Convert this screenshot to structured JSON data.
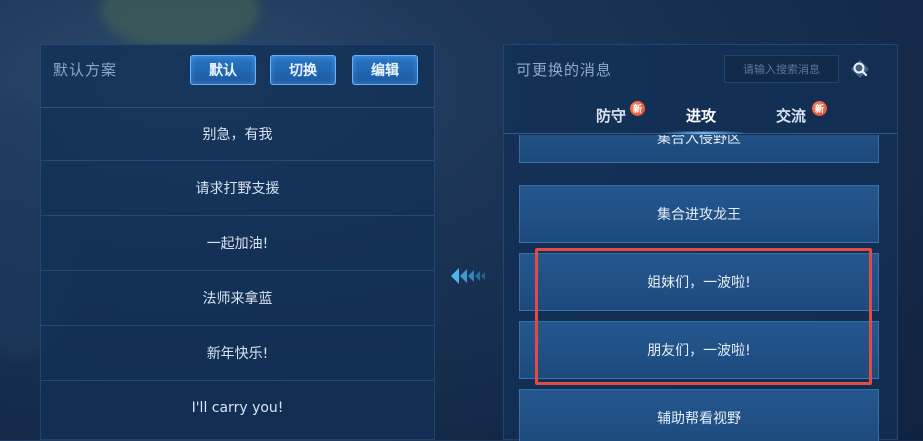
{
  "left_panel": {
    "title": "默认方案",
    "buttons": [
      {
        "label": "默认"
      },
      {
        "label": "切换"
      },
      {
        "label": "编辑"
      }
    ],
    "messages": [
      "别急，有我",
      "请求打野支援",
      "一起加油!",
      "法师来拿蓝",
      "新年快乐!",
      "I'll carry you!"
    ]
  },
  "right_panel": {
    "title": "可更换的消息",
    "search": {
      "placeholder": "请输入搜索消息"
    },
    "tabs": [
      {
        "label": "防守",
        "badge": "新",
        "active": false
      },
      {
        "label": "进攻",
        "badge": "",
        "active": true
      },
      {
        "label": "交流",
        "badge": "新",
        "active": false
      }
    ],
    "messages": [
      "集合入侵野区",
      "集合进攻龙王",
      "姐妹们，一波啦!",
      "朋友们，一波啦!",
      "辅助帮看视野"
    ]
  },
  "colors": {
    "highlight_border": "#e14a45",
    "button_border": "#5fb4ff",
    "accent": "#9fd4ff"
  },
  "icons": [
    "search-icon",
    "transfer-arrow-icon",
    "new-badge-icon"
  ]
}
